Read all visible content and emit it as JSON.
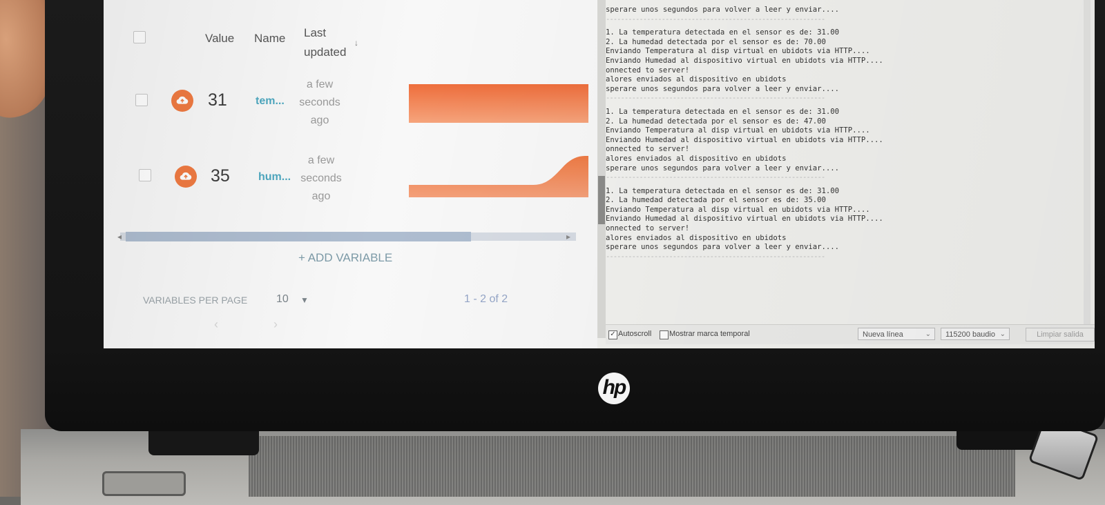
{
  "table": {
    "headers": {
      "value": "Value",
      "name": "Name",
      "last_updated_1": "Last",
      "last_updated_2": "updated",
      "sort": "↓"
    },
    "rows": [
      {
        "value": "31",
        "name": "tem...",
        "t1": "a few",
        "t2": "seconds",
        "t3": "ago"
      },
      {
        "value": "35",
        "name": "hum...",
        "t1": "a few",
        "t2": "seconds",
        "t3": "ago"
      }
    ],
    "add_variable": "+ ADD VARIABLE",
    "per_page_label": "VARIABLES PER PAGE",
    "per_page_value": "10",
    "pager": "1 - 2 of 2"
  },
  "colors": {
    "accent": "#f07b42",
    "link": "#4ea8c0"
  },
  "icons": {
    "row_icon": "cloud-upload-icon",
    "dropdown": "chevron-down-icon"
  },
  "serial": {
    "lines": [
      "sperare unos segundos para volver a leer y enviar....",
      "-----------------------------------------------------------",
      "",
      "1. La temperatura detectada en el sensor es de: 31.00",
      "2. La humedad detectada por el sensor es de: 70.00",
      "Enviando Temperatura al disp virtual en ubidots via HTTP....",
      "Enviando Humedad al dispositivo virtual en ubidots via HTTP....",
      "onnected to server!",
      "alores enviados al dispositivo en ubidots",
      "sperare unos segundos para volver a leer y enviar....",
      "-----------------------------------------------------------",
      "",
      "1. La temperatura detectada en el sensor es de: 31.00",
      "2. La humedad detectada por el sensor es de: 47.00",
      "Enviando Temperatura al disp virtual en ubidots via HTTP....",
      "Enviando Humedad al dispositivo virtual en ubidots via HTTP....",
      "onnected to server!",
      "alores enviados al dispositivo en ubidots",
      "sperare unos segundos para volver a leer y enviar....",
      "-----------------------------------------------------------",
      "",
      "1. La temperatura detectada en el sensor es de: 31.00",
      "2. La humedad detectada por el sensor es de: 35.00",
      "Enviando Temperatura al disp virtual en ubidots via HTTP....",
      "Enviando Humedad al dispositivo virtual en ubidots via HTTP....",
      "onnected to server!",
      "alores enviados al dispositivo en ubidots",
      "sperare unos segundos para volver a leer y enviar....",
      "-----------------------------------------------------------"
    ],
    "autoscroll": "Autoscroll",
    "timestamp": "Mostrar marca temporal",
    "line_ending": "Nueva línea",
    "baud": "115200 baudio",
    "clear": "Limpiar salida"
  },
  "brand": "hp"
}
